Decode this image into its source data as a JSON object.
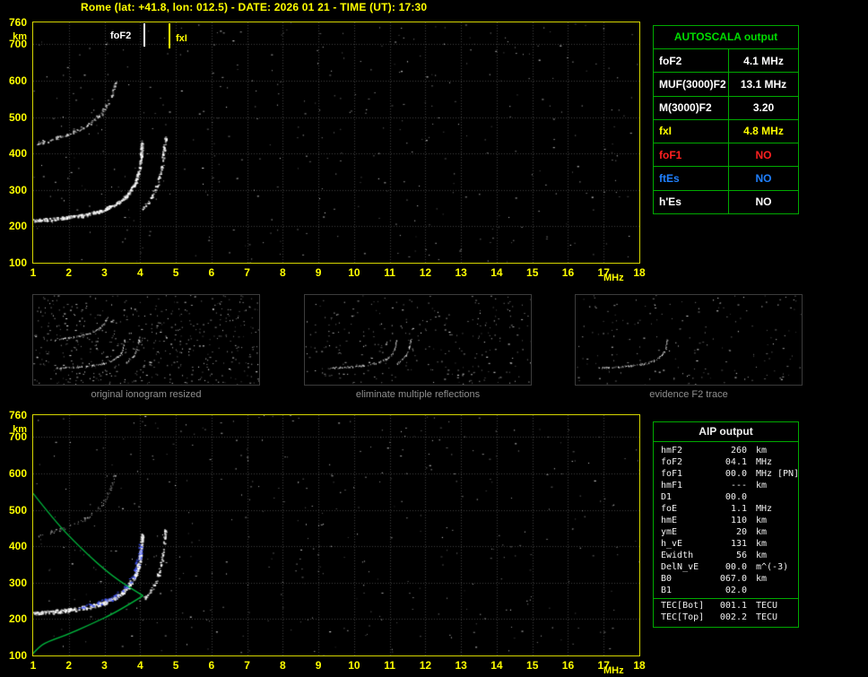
{
  "title": "Rome (lat: +41.8, lon: 012.5) - DATE: 2026 01 21 - TIME (UT): 17:30",
  "colors": {
    "background": "#000000",
    "axis_yellow": "#ffff00",
    "frame_yellow": "#d6d600",
    "grid_gray": "#414141",
    "trace_white": "#ffffff",
    "profile_green": "#00c040",
    "restored_blue": "#4055ff",
    "table_border_green": "#00aa00",
    "table_title_green": "#00dd00",
    "no_red": "#ff2020",
    "es_blue": "#2080ff",
    "caption_gray": "#8f8f8f"
  },
  "ionogram": {
    "x_label": "MHz",
    "y_label": "km",
    "x_ticks": [
      1,
      2,
      3,
      4,
      5,
      6,
      7,
      8,
      9,
      10,
      11,
      12,
      13,
      14,
      15,
      16,
      17,
      18
    ],
    "y_ticks": [
      760,
      700,
      600,
      500,
      400,
      300,
      200,
      100
    ],
    "x_range_mhz": [
      1,
      18
    ],
    "y_range_km": [
      100,
      760
    ]
  },
  "autoscala": {
    "title": "AUTOSCALA output",
    "rows": [
      {
        "param": "foF2",
        "value": "4.1 MHz",
        "color": "#ffffff"
      },
      {
        "param": "MUF(3000)F2",
        "value": "13.1 MHz",
        "color": "#ffffff"
      },
      {
        "param": "M(3000)F2",
        "value": "3.20",
        "color": "#ffffff"
      },
      {
        "param": "fxI",
        "value": "4.8 MHz",
        "color": "#ffff00"
      },
      {
        "param": "foF1",
        "value": "NO",
        "color": "#ff2020"
      },
      {
        "param": "ftEs",
        "value": "NO",
        "color": "#2080ff"
      },
      {
        "param": "h'Es",
        "value": "NO",
        "color": "#ffffff"
      }
    ]
  },
  "thumbnails": [
    {
      "caption": "original ionogram resized"
    },
    {
      "caption": "eliminate multiple reflections"
    },
    {
      "caption": "evidence F2 trace"
    }
  ],
  "aip": {
    "title": "AIP output",
    "rows": [
      {
        "param": "hmF2",
        "value": "260",
        "unit": "km",
        "note": ""
      },
      {
        "param": "foF2",
        "value": "04.1",
        "unit": "MHz",
        "note": ""
      },
      {
        "param": "foF1",
        "value": "00.0",
        "unit": "MHz",
        "note": "[PN]"
      },
      {
        "param": "hmF1",
        "value": "---",
        "unit": "km",
        "note": ""
      },
      {
        "param": "D1",
        "value": "00.0",
        "unit": "",
        "note": ""
      },
      {
        "param": "foE",
        "value": "1.1",
        "unit": "MHz",
        "note": ""
      },
      {
        "param": "hmE",
        "value": "110",
        "unit": "km",
        "note": ""
      },
      {
        "param": "ymE",
        "value": "20",
        "unit": "km",
        "note": ""
      },
      {
        "param": "h_vE",
        "value": "131",
        "unit": "km",
        "note": ""
      },
      {
        "param": "Ewidth",
        "value": "56",
        "unit": "km",
        "note": ""
      },
      {
        "param": "DelN_vE",
        "value": "00.0",
        "unit": "m^(-3)",
        "note": ""
      },
      {
        "param": "B0",
        "value": "067.0",
        "unit": "km",
        "note": ""
      },
      {
        "param": "B1",
        "value": "02.0",
        "unit": "",
        "note": ""
      }
    ],
    "tec_rows": [
      {
        "param": "TEC[Bot]",
        "value": "001.1",
        "unit": "TECU",
        "note": ""
      },
      {
        "param": "TEC[Top]",
        "value": "002.2",
        "unit": "TECU",
        "note": ""
      }
    ]
  },
  "chart_data": [
    {
      "type": "scatter",
      "title": "scaled ionogram (top panel)",
      "xlabel": "MHz",
      "ylabel": "km",
      "xlim": [
        1,
        18
      ],
      "ylim": [
        100,
        760
      ],
      "grid": true,
      "legend_position": "none",
      "series": [
        {
          "name": "F2 O-mode trace",
          "color": "#ffffff",
          "points": [
            [
              1.0,
              216
            ],
            [
              1.4,
              219
            ],
            [
              1.9,
              224
            ],
            [
              2.4,
              231
            ],
            [
              2.9,
              243
            ],
            [
              3.3,
              260
            ],
            [
              3.6,
              283
            ],
            [
              3.85,
              318
            ],
            [
              3.98,
              362
            ],
            [
              4.05,
              432
            ]
          ]
        },
        {
          "name": "F2 X-mode trace",
          "color": "#ffffff",
          "points": [
            [
              4.05,
              248
            ],
            [
              4.25,
              272
            ],
            [
              4.45,
              308
            ],
            [
              4.6,
              362
            ],
            [
              4.7,
              445
            ]
          ]
        },
        {
          "name": "second-hop echo",
          "color": "#e0e0e0",
          "points": [
            [
              1.1,
              428
            ],
            [
              1.6,
              442
            ],
            [
              2.1,
              458
            ],
            [
              2.5,
              478
            ],
            [
              2.9,
              510
            ],
            [
              3.15,
              552
            ],
            [
              3.3,
              598
            ]
          ]
        }
      ],
      "markers": [
        {
          "label": "foF2",
          "x_mhz": 4.1,
          "color": "#ffffff"
        },
        {
          "label": "fxI",
          "x_mhz": 4.8,
          "color": "#ffff00"
        }
      ]
    },
    {
      "type": "scatter",
      "title": "ionogram with AIP restored profile (bottom panel)",
      "xlabel": "MHz",
      "ylabel": "km",
      "xlim": [
        1,
        18
      ],
      "ylim": [
        100,
        760
      ],
      "grid": true,
      "series": [
        {
          "name": "electron density profile topside",
          "color": "#00c040",
          "points": [
            [
              1.0,
              545
            ],
            [
              1.6,
              470
            ],
            [
              2.3,
              398
            ],
            [
              3.2,
              318
            ],
            [
              4.08,
              264
            ]
          ]
        },
        {
          "name": "electron density profile bottomside",
          "color": "#00c040",
          "points": [
            [
              4.08,
              264
            ],
            [
              3.4,
              222
            ],
            [
              2.6,
              185
            ],
            [
              1.9,
              155
            ],
            [
              1.3,
              134
            ],
            [
              1.05,
              112
            ],
            [
              1.0,
              105
            ]
          ]
        },
        {
          "name": "restored F2 trace points",
          "color": "#4055ff",
          "points": [
            [
              2.3,
              233
            ],
            [
              2.7,
              241
            ],
            [
              3.0,
              251
            ],
            [
              3.3,
              263
            ],
            [
              3.6,
              290
            ],
            [
              3.8,
              320
            ],
            [
              3.95,
              362
            ],
            [
              4.02,
              412
            ]
          ]
        }
      ]
    }
  ]
}
